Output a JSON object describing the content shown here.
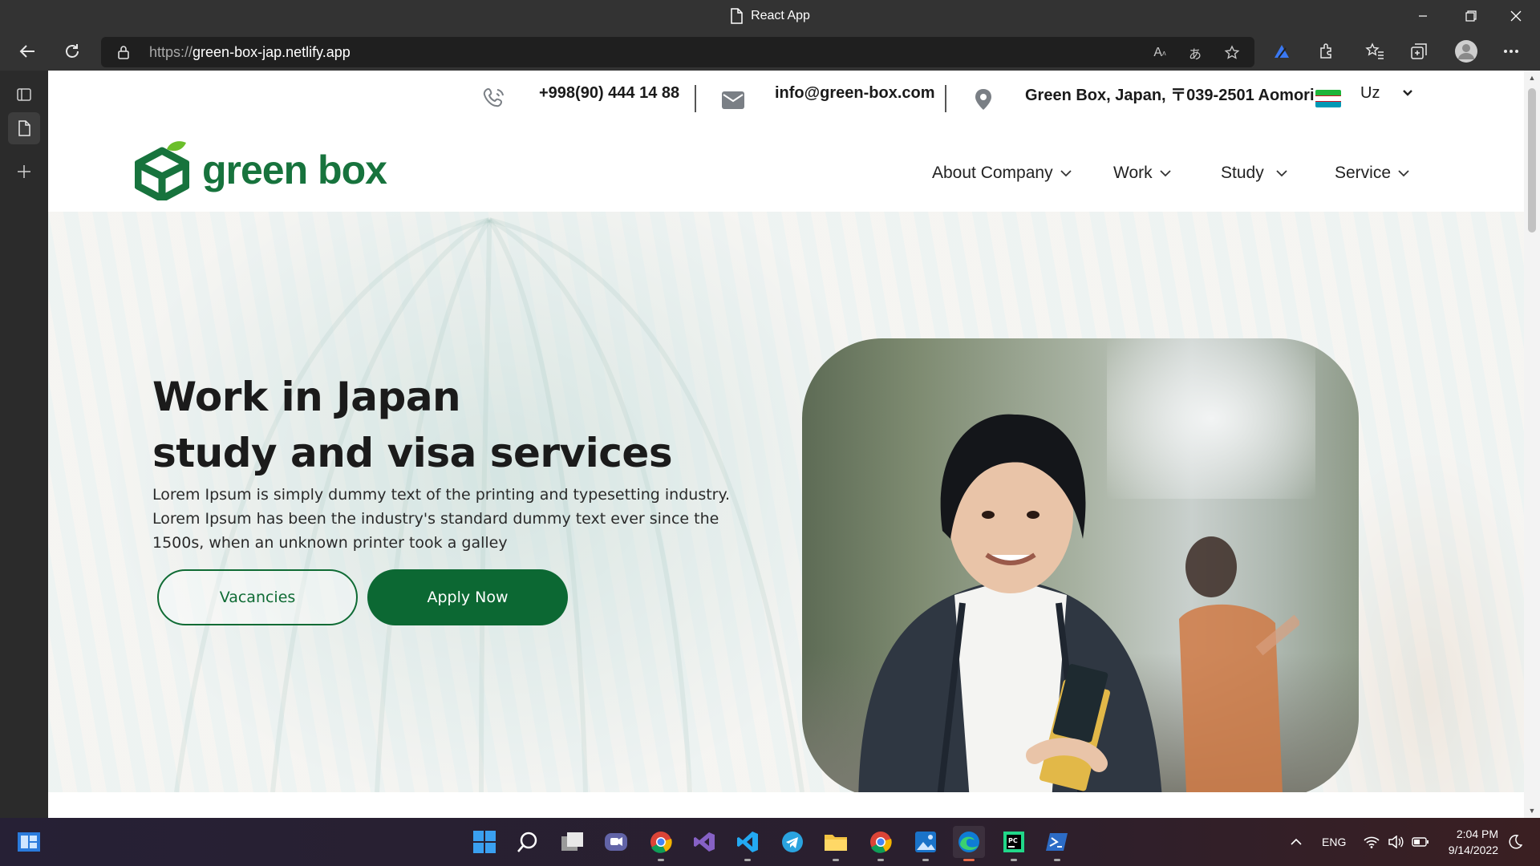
{
  "window": {
    "title": "React App"
  },
  "browser": {
    "url_proto": "https://",
    "url_host": "green-box-jap.netlify.app"
  },
  "topbar": {
    "phone": "+998(90) 444 14 88",
    "email": "info@green-box.com",
    "address": "Green Box, Japan, 〒039-2501 Aomori",
    "language": "Uz",
    "flag_colors": [
      "#1eb53a",
      "#ffffff",
      "#0099b5"
    ]
  },
  "logo": {
    "text": "green box",
    "color": "#17733d"
  },
  "nav": {
    "items": [
      {
        "label": "About Company"
      },
      {
        "label": "Work"
      },
      {
        "label": "Study"
      },
      {
        "label": "Service"
      }
    ]
  },
  "hero": {
    "title_line1": "Work in Japan",
    "title_line2": "study and visa services",
    "description": "Lorem Ipsum is simply dummy text of the printing and typesetting industry. Lorem Ipsum has been the industry's standard dummy text ever since the 1500s, when an unknown printer took a galley",
    "vacancies_label": "Vacancies",
    "apply_label": "Apply Now",
    "accent_color": "#0c6833"
  },
  "taskbar": {
    "language": "ENG",
    "time": "2:04 PM",
    "date": "9/14/2022",
    "apps": [
      "start",
      "search",
      "task-view",
      "teams",
      "chrome",
      "visual-studio",
      "vscode",
      "telegram",
      "file-explorer",
      "chrome",
      "photos",
      "edge",
      "pycharm",
      "terminal"
    ]
  }
}
